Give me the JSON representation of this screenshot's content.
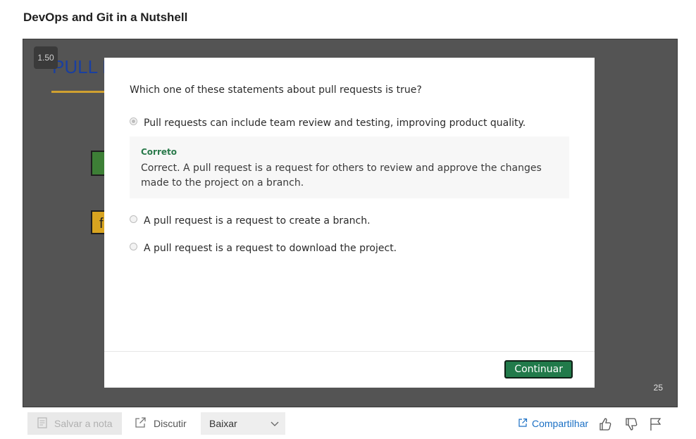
{
  "page": {
    "title": "DevOps and Git in a Nutshell"
  },
  "player": {
    "speed": "1.50",
    "slide_title": "PULL R",
    "slide_box_letter": "f",
    "page_number": "25"
  },
  "quiz": {
    "question": "Which one of these statements about pull requests is true?",
    "options": [
      {
        "label": "Pull requests can include team review and testing, improving product quality.",
        "selected": true
      },
      {
        "label": "A pull request is a request to create a branch.",
        "selected": false
      },
      {
        "label": "A pull request is a request to download the project.",
        "selected": false
      }
    ],
    "feedback": {
      "label": "Correto",
      "text": "Correct. A pull request is a request for others to review and approve the changes made to the project on a branch."
    },
    "continue_label": "Continuar"
  },
  "toolbar": {
    "save_note_label": "Salvar a nota",
    "discuss_label": "Discutir",
    "download_label": "Baixar",
    "share_label": "Compartilhar"
  },
  "icons": {
    "save_note": "note-icon",
    "discuss": "external-link-icon",
    "download_chevron": "chevron-down-icon",
    "share": "share-icon",
    "like": "thumbs-up-icon",
    "dislike": "thumbs-down-icon",
    "report": "flag-icon"
  },
  "colors": {
    "accent_green": "#217a4a",
    "feedback_green": "#2a7a4b",
    "link_blue": "#1a6fc4",
    "player_bg": "#545454"
  }
}
